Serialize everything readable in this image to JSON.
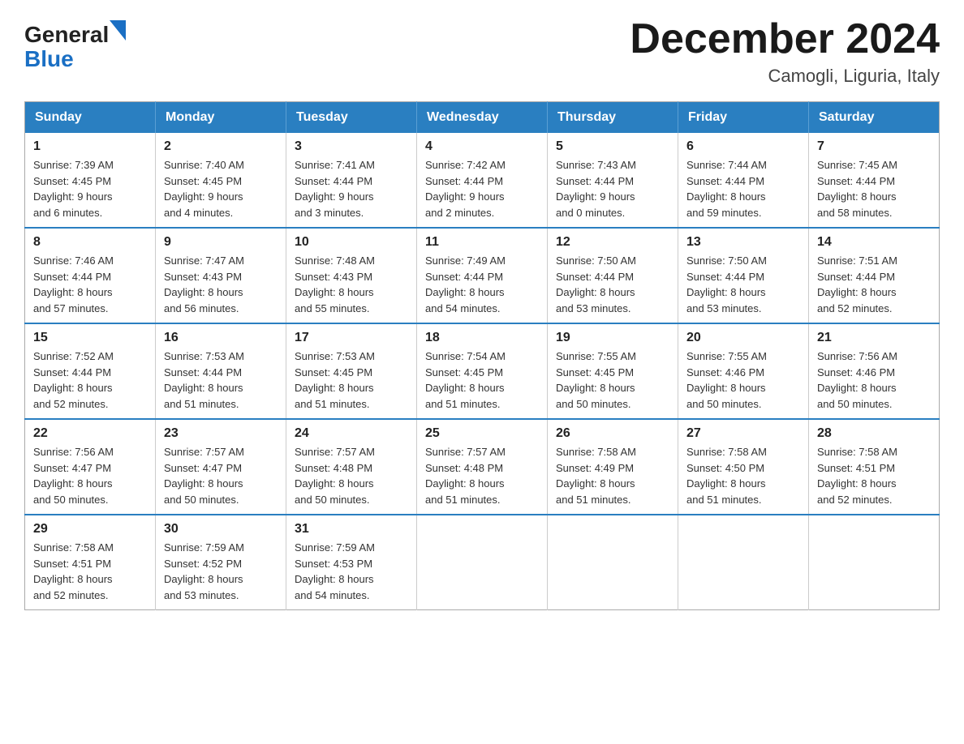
{
  "header": {
    "logo_general": "General",
    "logo_blue": "Blue",
    "title": "December 2024",
    "subtitle": "Camogli, Liguria, Italy"
  },
  "days_of_week": [
    "Sunday",
    "Monday",
    "Tuesday",
    "Wednesday",
    "Thursday",
    "Friday",
    "Saturday"
  ],
  "weeks": [
    [
      {
        "day": "1",
        "sunrise": "7:39 AM",
        "sunset": "4:45 PM",
        "daylight_hours": "9 hours",
        "daylight_minutes": "and 6 minutes."
      },
      {
        "day": "2",
        "sunrise": "7:40 AM",
        "sunset": "4:45 PM",
        "daylight_hours": "9 hours",
        "daylight_minutes": "and 4 minutes."
      },
      {
        "day": "3",
        "sunrise": "7:41 AM",
        "sunset": "4:44 PM",
        "daylight_hours": "9 hours",
        "daylight_minutes": "and 3 minutes."
      },
      {
        "day": "4",
        "sunrise": "7:42 AM",
        "sunset": "4:44 PM",
        "daylight_hours": "9 hours",
        "daylight_minutes": "and 2 minutes."
      },
      {
        "day": "5",
        "sunrise": "7:43 AM",
        "sunset": "4:44 PM",
        "daylight_hours": "9 hours",
        "daylight_minutes": "and 0 minutes."
      },
      {
        "day": "6",
        "sunrise": "7:44 AM",
        "sunset": "4:44 PM",
        "daylight_hours": "8 hours",
        "daylight_minutes": "and 59 minutes."
      },
      {
        "day": "7",
        "sunrise": "7:45 AM",
        "sunset": "4:44 PM",
        "daylight_hours": "8 hours",
        "daylight_minutes": "and 58 minutes."
      }
    ],
    [
      {
        "day": "8",
        "sunrise": "7:46 AM",
        "sunset": "4:44 PM",
        "daylight_hours": "8 hours",
        "daylight_minutes": "and 57 minutes."
      },
      {
        "day": "9",
        "sunrise": "7:47 AM",
        "sunset": "4:43 PM",
        "daylight_hours": "8 hours",
        "daylight_minutes": "and 56 minutes."
      },
      {
        "day": "10",
        "sunrise": "7:48 AM",
        "sunset": "4:43 PM",
        "daylight_hours": "8 hours",
        "daylight_minutes": "and 55 minutes."
      },
      {
        "day": "11",
        "sunrise": "7:49 AM",
        "sunset": "4:44 PM",
        "daylight_hours": "8 hours",
        "daylight_minutes": "and 54 minutes."
      },
      {
        "day": "12",
        "sunrise": "7:50 AM",
        "sunset": "4:44 PM",
        "daylight_hours": "8 hours",
        "daylight_minutes": "and 53 minutes."
      },
      {
        "day": "13",
        "sunrise": "7:50 AM",
        "sunset": "4:44 PM",
        "daylight_hours": "8 hours",
        "daylight_minutes": "and 53 minutes."
      },
      {
        "day": "14",
        "sunrise": "7:51 AM",
        "sunset": "4:44 PM",
        "daylight_hours": "8 hours",
        "daylight_minutes": "and 52 minutes."
      }
    ],
    [
      {
        "day": "15",
        "sunrise": "7:52 AM",
        "sunset": "4:44 PM",
        "daylight_hours": "8 hours",
        "daylight_minutes": "and 52 minutes."
      },
      {
        "day": "16",
        "sunrise": "7:53 AM",
        "sunset": "4:44 PM",
        "daylight_hours": "8 hours",
        "daylight_minutes": "and 51 minutes."
      },
      {
        "day": "17",
        "sunrise": "7:53 AM",
        "sunset": "4:45 PM",
        "daylight_hours": "8 hours",
        "daylight_minutes": "and 51 minutes."
      },
      {
        "day": "18",
        "sunrise": "7:54 AM",
        "sunset": "4:45 PM",
        "daylight_hours": "8 hours",
        "daylight_minutes": "and 51 minutes."
      },
      {
        "day": "19",
        "sunrise": "7:55 AM",
        "sunset": "4:45 PM",
        "daylight_hours": "8 hours",
        "daylight_minutes": "and 50 minutes."
      },
      {
        "day": "20",
        "sunrise": "7:55 AM",
        "sunset": "4:46 PM",
        "daylight_hours": "8 hours",
        "daylight_minutes": "and 50 minutes."
      },
      {
        "day": "21",
        "sunrise": "7:56 AM",
        "sunset": "4:46 PM",
        "daylight_hours": "8 hours",
        "daylight_minutes": "and 50 minutes."
      }
    ],
    [
      {
        "day": "22",
        "sunrise": "7:56 AM",
        "sunset": "4:47 PM",
        "daylight_hours": "8 hours",
        "daylight_minutes": "and 50 minutes."
      },
      {
        "day": "23",
        "sunrise": "7:57 AM",
        "sunset": "4:47 PM",
        "daylight_hours": "8 hours",
        "daylight_minutes": "and 50 minutes."
      },
      {
        "day": "24",
        "sunrise": "7:57 AM",
        "sunset": "4:48 PM",
        "daylight_hours": "8 hours",
        "daylight_minutes": "and 50 minutes."
      },
      {
        "day": "25",
        "sunrise": "7:57 AM",
        "sunset": "4:48 PM",
        "daylight_hours": "8 hours",
        "daylight_minutes": "and 51 minutes."
      },
      {
        "day": "26",
        "sunrise": "7:58 AM",
        "sunset": "4:49 PM",
        "daylight_hours": "8 hours",
        "daylight_minutes": "and 51 minutes."
      },
      {
        "day": "27",
        "sunrise": "7:58 AM",
        "sunset": "4:50 PM",
        "daylight_hours": "8 hours",
        "daylight_minutes": "and 51 minutes."
      },
      {
        "day": "28",
        "sunrise": "7:58 AM",
        "sunset": "4:51 PM",
        "daylight_hours": "8 hours",
        "daylight_minutes": "and 52 minutes."
      }
    ],
    [
      {
        "day": "29",
        "sunrise": "7:58 AM",
        "sunset": "4:51 PM",
        "daylight_hours": "8 hours",
        "daylight_minutes": "and 52 minutes."
      },
      {
        "day": "30",
        "sunrise": "7:59 AM",
        "sunset": "4:52 PM",
        "daylight_hours": "8 hours",
        "daylight_minutes": "and 53 minutes."
      },
      {
        "day": "31",
        "sunrise": "7:59 AM",
        "sunset": "4:53 PM",
        "daylight_hours": "8 hours",
        "daylight_minutes": "and 54 minutes."
      },
      null,
      null,
      null,
      null
    ]
  ],
  "labels": {
    "sunrise_label": "Sunrise:",
    "sunset_label": "Sunset:",
    "daylight_label": "Daylight:"
  }
}
